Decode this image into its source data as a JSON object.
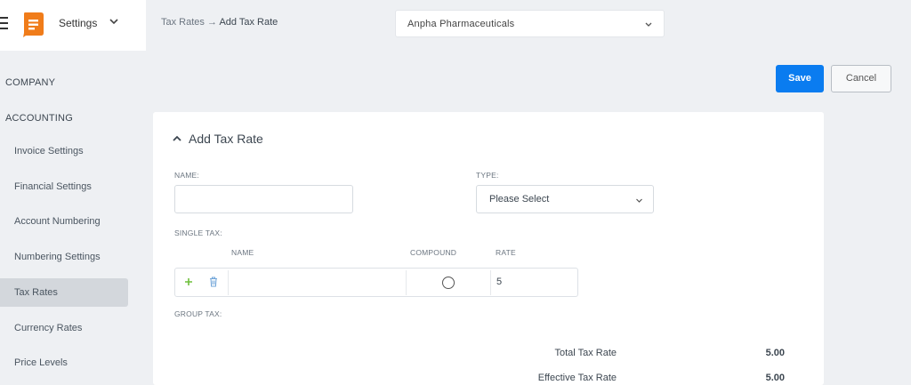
{
  "header": {
    "menu_label": "Settings",
    "breadcrumb_parent": "Tax Rates",
    "breadcrumb_arrow": "→",
    "breadcrumb_current": "Add Tax Rate",
    "company": "Anpha Pharmaceuticals"
  },
  "sidebar": {
    "sections": [
      "COMPANY",
      "ACCOUNTING"
    ],
    "items": [
      {
        "label": "Invoice Settings",
        "active": false
      },
      {
        "label": "Financial Settings",
        "active": false
      },
      {
        "label": "Account Numbering",
        "active": false
      },
      {
        "label": "Numbering Settings",
        "active": false
      },
      {
        "label": "Tax Rates",
        "active": true
      },
      {
        "label": "Currency Rates",
        "active": false
      },
      {
        "label": "Price Levels",
        "active": false
      }
    ]
  },
  "actions": {
    "save": "Save",
    "cancel": "Cancel"
  },
  "form": {
    "title": "Add Tax Rate",
    "name_label": "NAME:",
    "name_value": "",
    "type_label": "TYPE:",
    "type_value": "Please Select",
    "single_tax_label": "SINGLE TAX:",
    "columns": {
      "name": "NAME",
      "compound": "COMPOUND",
      "rate": "RATE"
    },
    "row": {
      "name": "",
      "compound": false,
      "rate": "5"
    },
    "group_tax_label": "GROUP TAX:",
    "total_label": "Total Tax Rate",
    "total_value": "5.00",
    "effective_label": "Effective Tax Rate",
    "effective_value": "5.00"
  },
  "colors": {
    "accent": "#0a7cf0",
    "add": "#6fbf3c",
    "logo": "#f07c1a"
  }
}
